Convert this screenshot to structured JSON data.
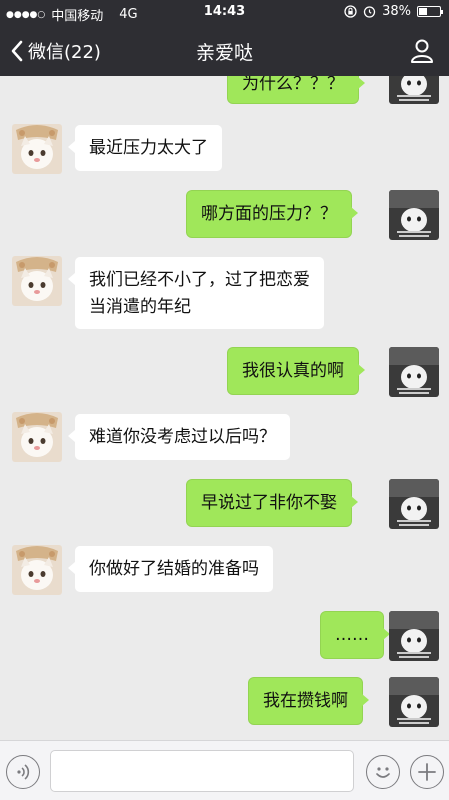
{
  "status": {
    "carrier": "中国移动",
    "network": "4G",
    "time": "14:43",
    "battery": "38%",
    "battery_level": 0.38
  },
  "nav": {
    "back_label": "微信(22)",
    "title": "亲爱哒"
  },
  "messages": [
    {
      "side": "out",
      "text": "为什么？？？"
    },
    {
      "side": "in",
      "text": "最近压力太大了"
    },
    {
      "side": "out",
      "text": "哪方面的压力？？"
    },
    {
      "side": "in",
      "line1": "我们已经不小了，过了把恋爱",
      "line2": "当消遣的年纪"
    },
    {
      "side": "out",
      "text": "我很认真的啊"
    },
    {
      "side": "in",
      "text": "难道你没考虑过以后吗？"
    },
    {
      "side": "out",
      "text": "早说过了非你不娶"
    },
    {
      "side": "in",
      "text": "你做好了结婚的准备吗"
    },
    {
      "side": "out",
      "text": "……"
    },
    {
      "side": "out",
      "text": "我在攒钱啊"
    }
  ],
  "icons": {
    "back": "chevron-left-icon",
    "user": "user-icon",
    "voice": "voice-icon",
    "emoji": "emoji-icon",
    "plus": "plus-icon"
  },
  "colors": {
    "header": "#2e2e33",
    "chat_bg": "#ebebeb",
    "outgoing": "#a0e75a",
    "incoming": "#ffffff"
  }
}
